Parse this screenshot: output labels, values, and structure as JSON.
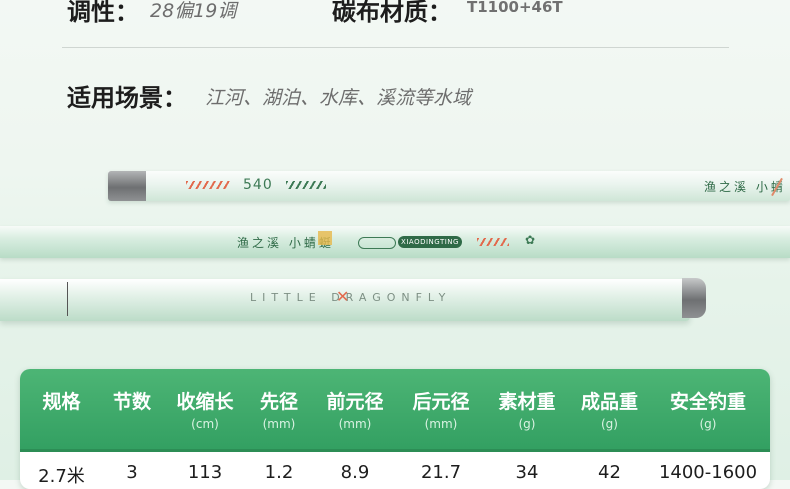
{
  "specs": {
    "tuning": {
      "label": "调性：",
      "value": "28偏19调"
    },
    "material": {
      "label": "碳布材质：",
      "value": "T1100+46T"
    },
    "scene": {
      "label": "适用场景：",
      "value": "江河、湖泊、水库、溪流等水域"
    }
  },
  "rods": {
    "rod1": {
      "length_mark": "540",
      "brand": "渔之溪 小蜻"
    },
    "rod2": {
      "brand": "渔之溪 小蜻蜓",
      "pill_small": "",
      "pill_main": "XIAODINGTING",
      "logo_glyph": "✿"
    },
    "rod3": {
      "brand": "LITTLE DRAGONFLY",
      "mark": "✕"
    }
  },
  "table": {
    "columns": [
      {
        "header": "规格",
        "unit": "",
        "value": "2.7米"
      },
      {
        "header": "节数",
        "unit": "",
        "value": "3"
      },
      {
        "header": "收缩长",
        "unit": "(cm)",
        "value": "113"
      },
      {
        "header": "先径",
        "unit": "(mm)",
        "value": "1.2"
      },
      {
        "header": "前元径",
        "unit": "(mm)",
        "value": "8.9"
      },
      {
        "header": "后元径",
        "unit": "(mm)",
        "value": "21.7"
      },
      {
        "header": "素材重",
        "unit": "(g)",
        "value": "34"
      },
      {
        "header": "成品重",
        "unit": "(g)",
        "value": "42"
      },
      {
        "header": "安全钓重",
        "unit": "(g)",
        "value": "1400-1600"
      }
    ]
  },
  "colors": {
    "accent_green": "#3aa667",
    "accent_orange": "#e26a4d"
  }
}
